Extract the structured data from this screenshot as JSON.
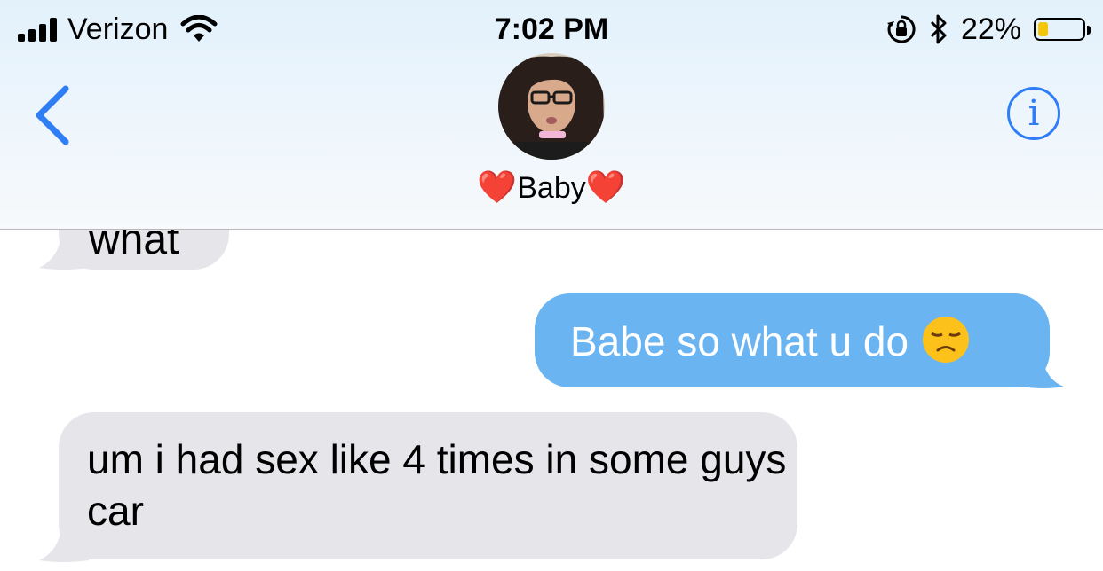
{
  "status_bar": {
    "carrier": "Verizon",
    "time": "7:02 PM",
    "battery_percent": "22%",
    "battery_level": 0.22
  },
  "header": {
    "contact_name": "Baby",
    "heart_left": "❤️",
    "heart_right": "❤️"
  },
  "messages": [
    {
      "direction": "incoming",
      "text": "what"
    },
    {
      "direction": "outgoing",
      "text": "Babe so what u do"
    },
    {
      "direction": "incoming",
      "text": "um i had sex like 4 times in some guys car"
    }
  ],
  "colors": {
    "accent": "#2f7ef6",
    "outgoing_bubble": "#6ab4f2",
    "incoming_bubble": "#e5e5ea"
  }
}
